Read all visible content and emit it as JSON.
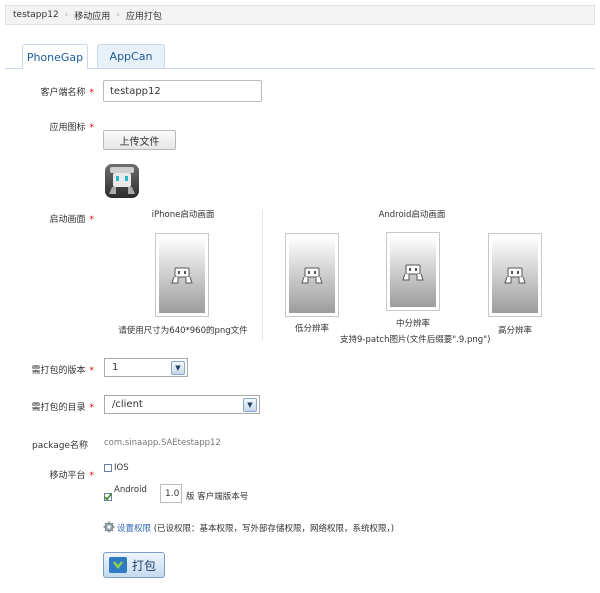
{
  "breadcrumb": [
    "testapp12",
    "移动应用",
    "应用打包"
  ],
  "tabs": [
    "PhoneGap",
    "AppCan"
  ],
  "form": {
    "client_name_label": "客户端名称",
    "client_name_value": "testapp12",
    "app_icon_label": "应用图标",
    "upload_button": "上传文件",
    "splash_label": "启动画面",
    "iphone_title": "iPhone启动画面",
    "iphone_caption": "请使用尺寸为640*960的png文件",
    "android_title": "Android启动画面",
    "android_low": "低分辨率",
    "android_mid": "中分辨率",
    "android_mid_note": "支持9-patch图片(文件后缀要\".9.png\")",
    "android_high": "高分辨率",
    "version_label": "需打包的版本",
    "version_value": "1",
    "dir_label": "需打包的目录",
    "dir_value": "/client",
    "package_label": "package名称",
    "package_value": "com.sinaapp.SAEtestapp12",
    "platform_label": "移动平台",
    "ios_label": "IOS",
    "android_label": "Android",
    "android_version": "1.0",
    "version_suffix": "版 客户端版本号",
    "permissions_link": "设置权限",
    "permissions_text": "(已设权限：基本权限，写外部存储权限，网络权限，系统权限，)",
    "build_button": "打包"
  },
  "checkbox_states": {
    "ios": false,
    "android": true
  }
}
